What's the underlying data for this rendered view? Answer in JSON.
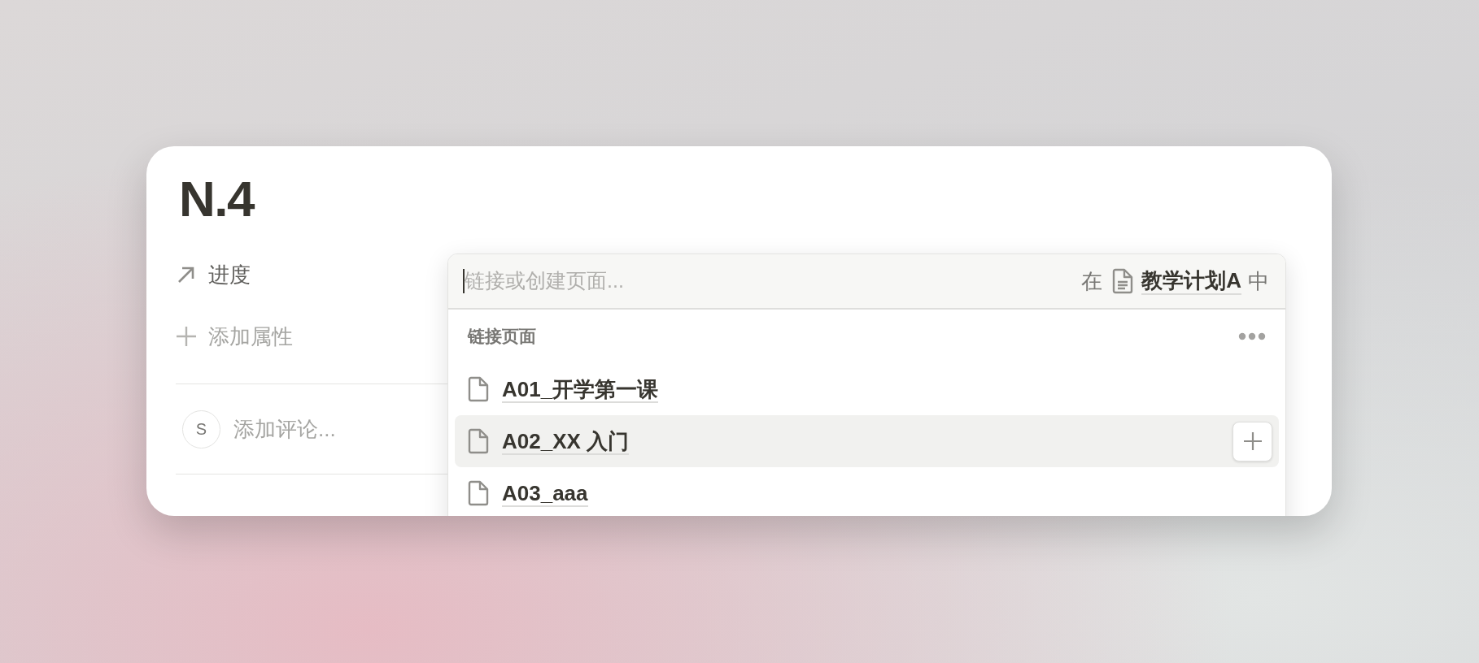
{
  "page": {
    "title": "N.4",
    "properties": [
      {
        "kind": "relation",
        "label": "进度"
      },
      {
        "kind": "add",
        "label": "添加属性"
      }
    ],
    "comment": {
      "avatar": "S",
      "placeholder": "添加评论..."
    }
  },
  "link_menu": {
    "search": {
      "placeholder": "链接或创建页面..."
    },
    "scope": {
      "prefix": "在",
      "page": "教学计划A",
      "suffix": "中"
    },
    "section": "链接页面",
    "items": [
      {
        "title": "A01_开学第一课",
        "selected": false
      },
      {
        "title": "A02_XX 入门",
        "selected": true
      },
      {
        "title": "A03_aaa",
        "selected": false
      }
    ]
  }
}
